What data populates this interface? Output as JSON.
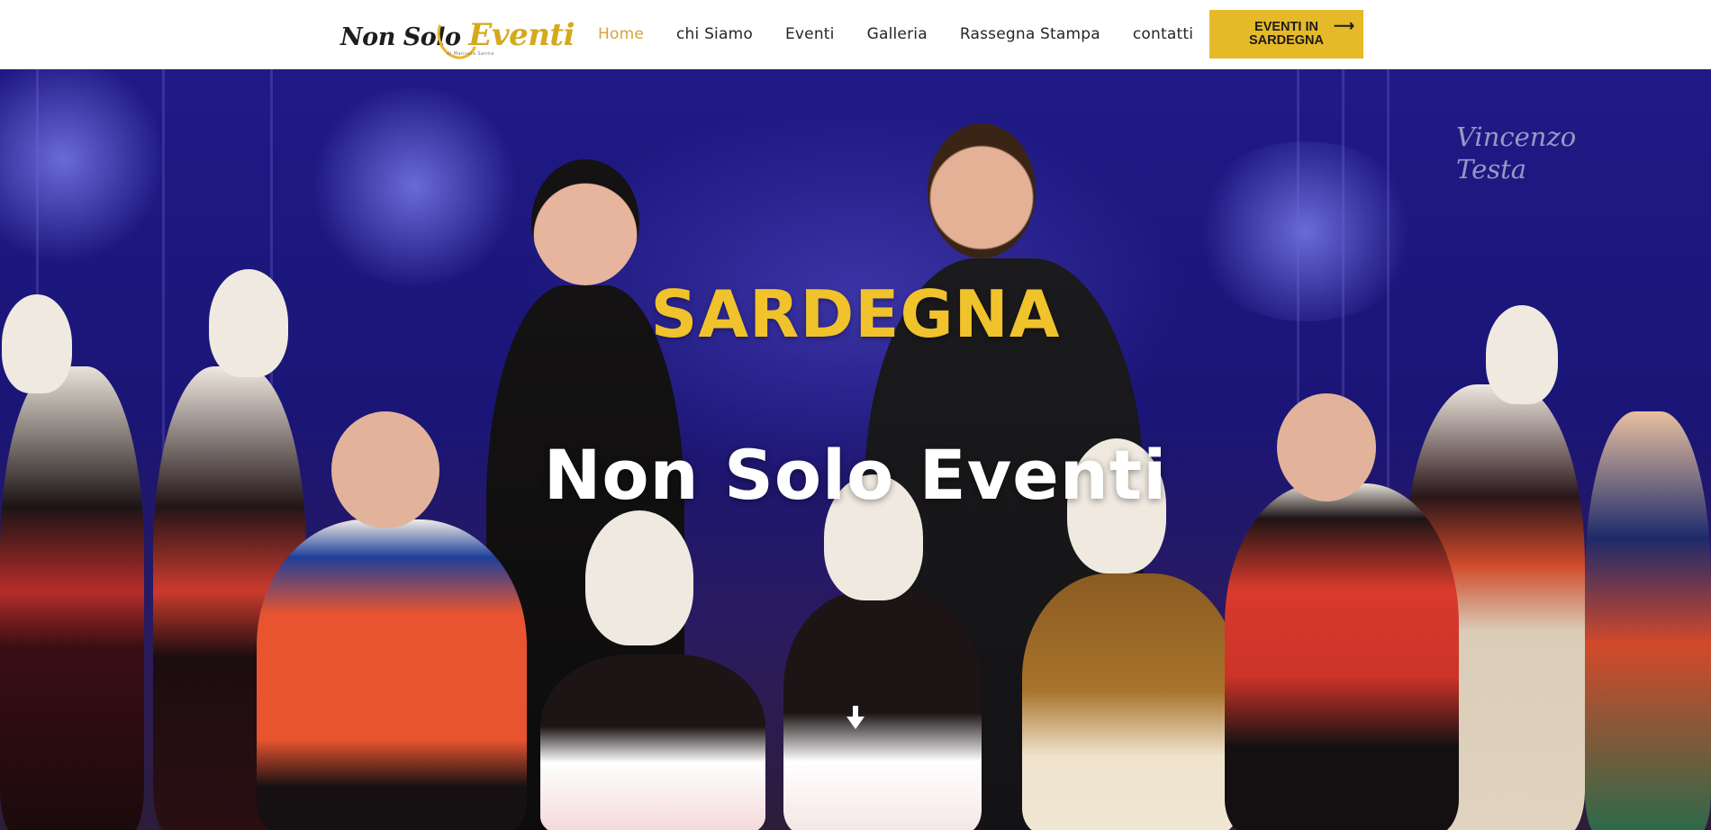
{
  "header": {
    "logo": {
      "text_main": "Non Solo",
      "text_accent": "Eventi",
      "subtitle": "di Manuela Sanna"
    },
    "nav": [
      {
        "label": "Home",
        "active": true
      },
      {
        "label": "chi Siamo",
        "active": false
      },
      {
        "label": "Eventi",
        "active": false
      },
      {
        "label": "Galleria",
        "active": false
      },
      {
        "label": "Rassegna Stampa",
        "active": false
      },
      {
        "label": "contatti",
        "active": false
      }
    ],
    "cta": {
      "label": "EVENTI IN SARDEGNA",
      "icon": "arrow-right-icon"
    }
  },
  "hero": {
    "kicker": "SARDEGNA",
    "title": "Non Solo Eventi",
    "watermark": "Vincenzo Testa",
    "scroll_icon": "arrow-down-icon"
  },
  "colors": {
    "accent": "#e6b928",
    "nav_active": "#d6a437",
    "hero_kicker": "#f0c22c",
    "hero_title": "#ffffff",
    "hero_background": "#1a1576"
  }
}
